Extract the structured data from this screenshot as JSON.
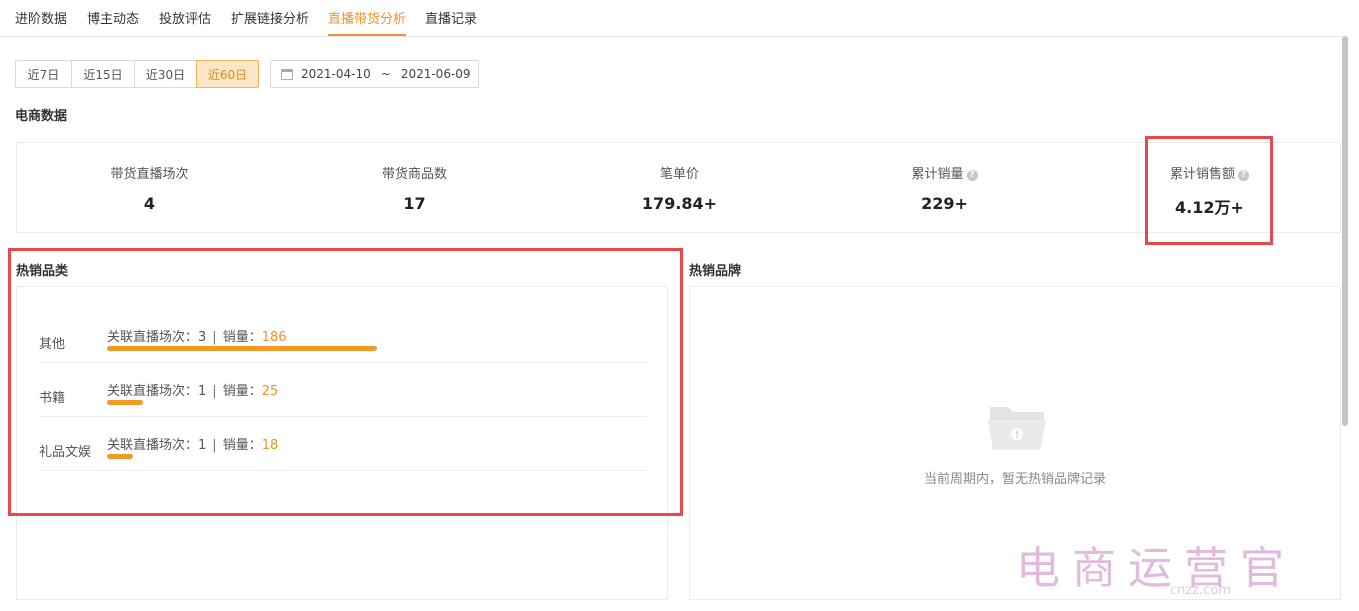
{
  "tabs": [
    "进阶数据",
    "博主动态",
    "投放评估",
    "扩展链接分析",
    "直播带货分析",
    "直播记录"
  ],
  "active_tab": "直播带货分析",
  "date_range": {
    "options": [
      "近7日",
      "近15日",
      "近30日",
      "近60日"
    ],
    "selected": "近60日",
    "start": "2021-04-10",
    "separator": "~",
    "end": "2021-06-09"
  },
  "ecommerce": {
    "title": "电商数据",
    "stats": [
      {
        "label": "带货直播场次",
        "value": "4"
      },
      {
        "label": "带货商品数",
        "value": "17"
      },
      {
        "label": "笔单价",
        "value": "179.84+"
      },
      {
        "label": "累计销量",
        "value": "229+",
        "help_icon": "question-icon"
      },
      {
        "label": "累计销售额",
        "value": "4.12万+",
        "help_icon": "question-icon"
      }
    ]
  },
  "hot_categories": {
    "title": "热销品类",
    "sessions_label": "关联直播场次：",
    "sales_label": "销量：",
    "divider": "|",
    "items": [
      {
        "name": "其他",
        "sessions": "3",
        "sales": "186",
        "share": 1.0
      },
      {
        "name": "书籍",
        "sessions": "1",
        "sales": "25",
        "share": 0.134
      },
      {
        "name": "礼品文娱",
        "sessions": "1",
        "sales": "18",
        "share": 0.097
      }
    ]
  },
  "hot_brands": {
    "title": "热销品牌",
    "empty_icon": "empty-folder-icon",
    "empty_text": "当前周期内，暂无热销品牌记录"
  },
  "watermark": {
    "text": "电商运营官",
    "sub": "cnzz.com"
  },
  "colors": {
    "accent": "#f0912b",
    "bar": "#f39a24",
    "highlight_box": "#e5484d",
    "active_range_bg": "#fde6c6"
  }
}
